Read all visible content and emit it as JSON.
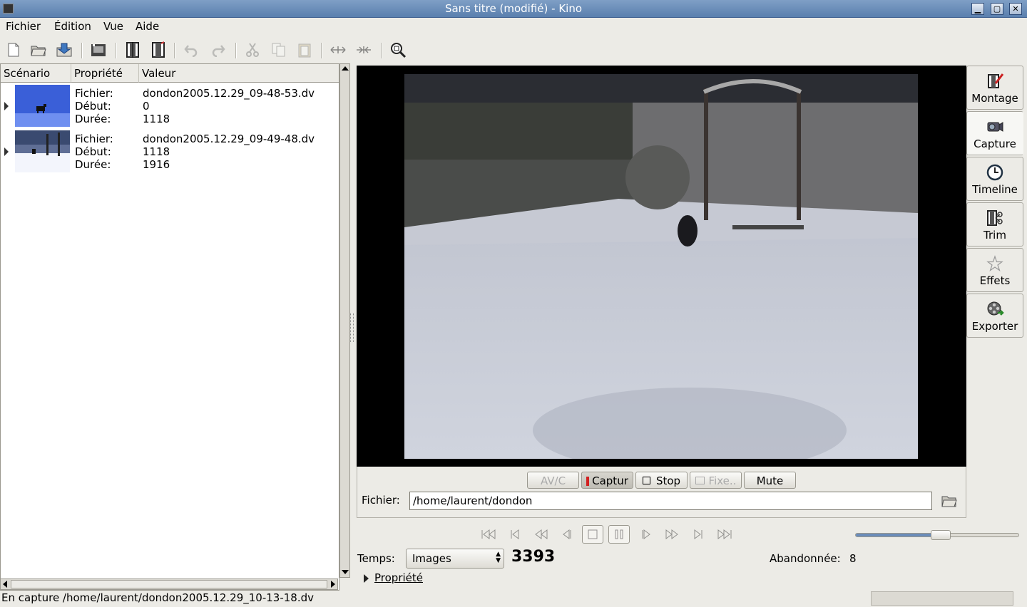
{
  "window": {
    "title": "Sans titre (modifié)  - Kino",
    "min": "▁",
    "max": "▢",
    "close": "✕"
  },
  "menu": [
    {
      "label": "Fichier"
    },
    {
      "label": "Édition"
    },
    {
      "label": "Vue"
    },
    {
      "label": "Aide"
    }
  ],
  "toolbar": [
    "new-icon",
    "open-icon",
    "save-icon",
    "save-frame-icon",
    "split-scene-icon",
    "join-scene-icon",
    "undo-icon",
    "redo-icon",
    "cut-icon",
    "copy-icon",
    "paste-icon",
    "expand-icon",
    "collapse-icon",
    "zoom-icon"
  ],
  "storyboard": {
    "headers": {
      "scenario": "Scénario",
      "property": "Propriété",
      "value": "Valeur"
    },
    "rows": [
      {
        "file_label": "Fichier:",
        "file": "dondon2005.12.29_09-48-53.dv",
        "start_label": "Début:",
        "start": "0",
        "duration_label": "Durée:",
        "duration": "1118"
      },
      {
        "file_label": "Fichier:",
        "file": "dondon2005.12.29_09-49-48.dv",
        "start_label": "Début:",
        "start": "1118",
        "duration_label": "Durée:",
        "duration": "1916"
      }
    ]
  },
  "capture": {
    "buttons": {
      "avc": "AV/C",
      "capture": "Captur",
      "stop": "Stop",
      "still": "Fixe..",
      "mute": "Mute"
    },
    "file_label": "Fichier:",
    "file_value": "/home/laurent/dondon"
  },
  "sidebar": [
    {
      "label": "Montage",
      "icon": "edit-icon"
    },
    {
      "label": "Capture",
      "icon": "capture-icon"
    },
    {
      "label": "Timeline",
      "icon": "clock-icon"
    },
    {
      "label": "Trim",
      "icon": "trim-icon"
    },
    {
      "label": "Effets",
      "icon": "effects-icon"
    },
    {
      "label": "Exporter",
      "icon": "export-icon"
    }
  ],
  "time": {
    "label": "Temps:",
    "mode": "Images",
    "frame": "3393",
    "dropped_label": "Abandonnée:",
    "dropped": "8"
  },
  "volume": {
    "level": 0.52
  },
  "properties_label": "Propriété",
  "status": "En capture /home/laurent/dondon2005.12.29_10-13-18.dv",
  "colors": {
    "titlebar": "#6a8cba",
    "window": "#ecebe6",
    "video_bg": "#000000",
    "record": "#d22020"
  }
}
